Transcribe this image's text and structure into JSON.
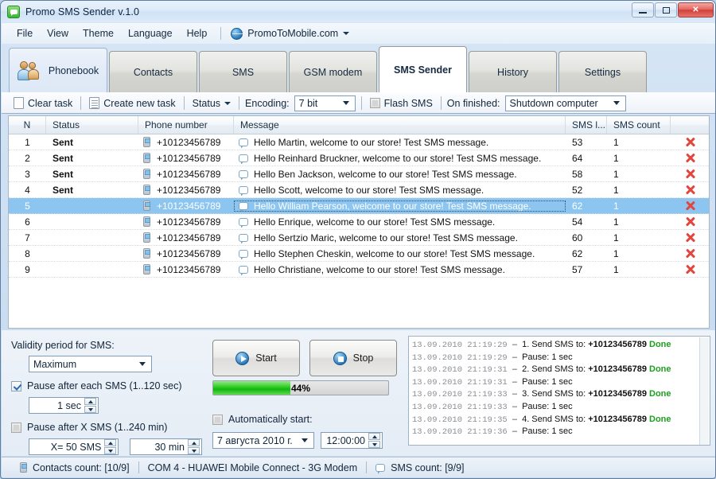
{
  "window": {
    "title": "Promo SMS Sender v.1.0",
    "app_icon": "sms-bubble-icon",
    "minimize": "minimize-icon",
    "maximize": "maximize-icon",
    "close": "close-icon"
  },
  "menu": {
    "items": [
      "File",
      "View",
      "Theme",
      "Language",
      "Help"
    ],
    "brand": "PromoToMobile.com",
    "brand_icon": "globe-icon"
  },
  "tabs": [
    {
      "label": "Phonebook",
      "icon": "people-icon",
      "active": false
    },
    {
      "label": "Contacts",
      "active": false
    },
    {
      "label": "SMS",
      "active": false
    },
    {
      "label": "GSM modem",
      "active": false
    },
    {
      "label": "SMS Sender",
      "active": true
    },
    {
      "label": "History",
      "active": false
    },
    {
      "label": "Settings",
      "active": false
    }
  ],
  "toolbar": {
    "clear_task": "Clear task",
    "create_new_task": "Create new task",
    "status": "Status",
    "encoding_label": "Encoding:",
    "encoding_value": "7 bit",
    "flash_sms": "Flash SMS",
    "flash_sms_checked": false,
    "on_finished_label": "On finished:",
    "on_finished_value": "Shutdown computer"
  },
  "grid": {
    "columns": [
      "N",
      "Status",
      "Phone number",
      "Message",
      "SMS l...",
      "SMS count",
      ""
    ],
    "selected_row": 5,
    "rows": [
      {
        "n": "1",
        "status": "Sent",
        "phone": "+10123456789",
        "message": "Hello Martin, welcome to our store! Test SMS message.",
        "length": "53",
        "count": "1"
      },
      {
        "n": "2",
        "status": "Sent",
        "phone": "+10123456789",
        "message": "Hello Reinhard Bruckner, welcome to our store! Test SMS message.",
        "length": "64",
        "count": "1"
      },
      {
        "n": "3",
        "status": "Sent",
        "phone": "+10123456789",
        "message": "Hello Ben Jackson, welcome to our store! Test SMS message.",
        "length": "58",
        "count": "1"
      },
      {
        "n": "4",
        "status": "Sent",
        "phone": "+10123456789",
        "message": "Hello Scott, welcome to our store! Test SMS message.",
        "length": "52",
        "count": "1"
      },
      {
        "n": "5",
        "status": "",
        "phone": "+10123456789",
        "message": "Hello William Pearson, welcome to our store! Test SMS message.",
        "length": "62",
        "count": "1"
      },
      {
        "n": "6",
        "status": "",
        "phone": "+10123456789",
        "message": "Hello Enrique, welcome to our store! Test SMS message.",
        "length": "54",
        "count": "1"
      },
      {
        "n": "7",
        "status": "",
        "phone": "+10123456789",
        "message": "Hello Sertzio Maric, welcome to our store! Test SMS message.",
        "length": "60",
        "count": "1"
      },
      {
        "n": "8",
        "status": "",
        "phone": "+10123456789",
        "message": "Hello Stephen Cheskin, welcome to our store! Test SMS message.",
        "length": "62",
        "count": "1"
      },
      {
        "n": "9",
        "status": "",
        "phone": "+10123456789",
        "message": "Hello Christiane, welcome to our store! Test SMS message.",
        "length": "57",
        "count": "1"
      }
    ]
  },
  "settings": {
    "validity_label": "Validity period for SMS:",
    "validity_value": "Maximum",
    "pause_each_label": "Pause after each SMS (1..120 sec)",
    "pause_each_checked": true,
    "pause_each_value": "1 sec",
    "pause_x_label": "Pause after X SMS (1..240 min)",
    "pause_x_checked": false,
    "pause_x_count": "X= 50 SMS",
    "pause_x_minutes": "30 min"
  },
  "controls": {
    "start": "Start",
    "stop": "Stop",
    "progress_percent": 44,
    "progress_text": "44%",
    "auto_start_label": "Automatically start:",
    "auto_start_checked": false,
    "auto_start_date": "7 августа  2010 г.",
    "auto_start_time": "12:00:00"
  },
  "log": {
    "lines": [
      {
        "ts": "13.09.2010 21:19:29",
        "pre": "1. Send SMS to: ",
        "num": "+10123456789",
        "post": " Done",
        "done": true
      },
      {
        "ts": "13.09.2010 21:19:29",
        "pre": "Pause: 1 sec",
        "num": "",
        "post": "",
        "done": false
      },
      {
        "ts": "13.09.2010 21:19:31",
        "pre": "2. Send SMS to: ",
        "num": "+10123456789",
        "post": " Done",
        "done": true
      },
      {
        "ts": "13.09.2010 21:19:31",
        "pre": "Pause: 1 sec",
        "num": "",
        "post": "",
        "done": false
      },
      {
        "ts": "13.09.2010 21:19:33",
        "pre": "3. Send SMS to: ",
        "num": "+10123456789",
        "post": " Done",
        "done": true
      },
      {
        "ts": "13.09.2010 21:19:33",
        "pre": "Pause: 1 sec",
        "num": "",
        "post": "",
        "done": false
      },
      {
        "ts": "13.09.2010 21:19:35",
        "pre": "4. Send SMS to: ",
        "num": "+10123456789",
        "post": " Done",
        "done": true
      },
      {
        "ts": "13.09.2010 21:19:36",
        "pre": "Pause: 1 sec",
        "num": "",
        "post": "",
        "done": false
      }
    ]
  },
  "statusbar": {
    "contacts": "Contacts count: [10/9]",
    "modem": "COM 4 - HUAWEI Mobile Connect - 3G Modem",
    "sms": "SMS count: [9/9]"
  },
  "colors": {
    "accent_green": "#1e9e1e",
    "selection_blue": "#8cc6f0",
    "delete_red": "#e2463f",
    "progress_green": "#13b512"
  }
}
